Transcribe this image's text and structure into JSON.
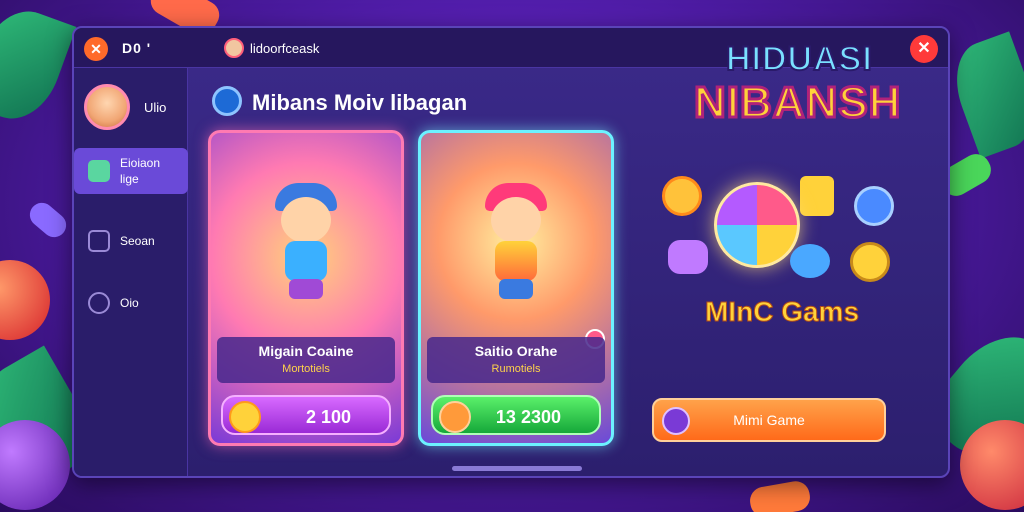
{
  "window": {
    "title_short": "D0 '",
    "url_text": "lidoorfceask"
  },
  "sidebar": {
    "profile_label": "Ulio",
    "items": [
      {
        "label": "Eioiaon",
        "sublabel": "lige"
      },
      {
        "label": "Seoan"
      },
      {
        "label": "Oio"
      }
    ]
  },
  "main": {
    "header": "Mibans Moiv libagan",
    "cards": [
      {
        "title": "Migain Coaine",
        "subtitle": "Mortotiels",
        "price": "2 100"
      },
      {
        "title": "Saitio Orahe",
        "subtitle": "Rumotiels",
        "price": "13 2300"
      }
    ]
  },
  "promo": {
    "logo_line1": "HIDUASI",
    "logo_line2": "NIBANSH",
    "section_title": "MInC Gams",
    "button_label": "Mimi Game"
  },
  "colors": {
    "accent_pink": "#ff7ab2",
    "accent_cyan": "#6cf2ff",
    "button_purple": "#9a2ad6",
    "button_green": "#16a83a",
    "button_orange": "#ff6a1a"
  }
}
